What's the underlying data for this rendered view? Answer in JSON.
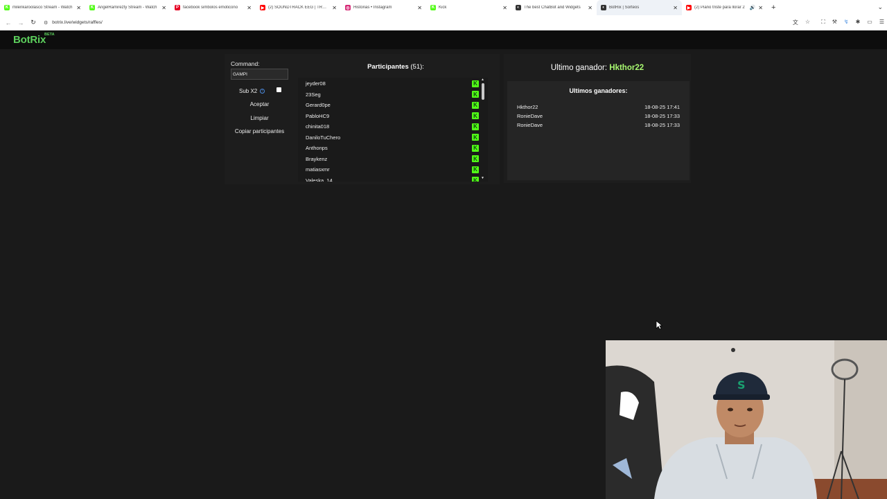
{
  "browser": {
    "tabs": [
      {
        "title": "milenkaroolasco Stream - Watch",
        "favicon": "K",
        "color": "#53fc18"
      },
      {
        "title": "AngelRamirezty Stream - Watch",
        "favicon": "K",
        "color": "#53fc18"
      },
      {
        "title": "facebook simbolos emoticono",
        "favicon": "P",
        "color": "#e60023"
      },
      {
        "title": "(2) SOUNDTRACK EEG | TROMP",
        "favicon": "▶",
        "color": "#ff0000"
      },
      {
        "title": "Historias • Instagram",
        "favicon": "◎",
        "color": "#d62976"
      },
      {
        "title": "Kick",
        "favicon": "K",
        "color": "#53fc18"
      },
      {
        "title": "The best ChatBot and Widgets",
        "favicon": "◐",
        "color": "#333333"
      },
      {
        "title": "BotRix | Sorteos",
        "favicon": "◐",
        "color": "#333333"
      },
      {
        "title": "(2) Piano triste para llorar 2",
        "favicon": "▶",
        "color": "#ff0000"
      }
    ],
    "new_tab": "+",
    "url": "botrix.live/widgets/raffles/"
  },
  "site": {
    "logo": "BotRix",
    "beta": "BETA"
  },
  "raffle": {
    "command_label": "Command:",
    "command_value": "GAMPI",
    "sub_label": "Sub X2",
    "sub_checked": false,
    "accept_label": "Aceptar",
    "clear_label": "Limpiar",
    "copy_label": "Copiar participantes",
    "participants_label": "Participantes",
    "participants_count": "(51):",
    "participants": [
      "jeyder08",
      "23Seg",
      "Gerard0pe",
      "PabloHC9",
      "chinita018",
      "DaniloTuChero",
      "Anthonps",
      "Braykenz",
      "matiasxmr",
      "Valeska_14"
    ],
    "platform_icon": "K"
  },
  "winners": {
    "last_winner_label": "Ultimo ganador:",
    "last_winner_name": "Hkthor22",
    "recent_label": "Ultimos ganadores:",
    "list": [
      {
        "name": "Hkthor22",
        "time": "18-08-25 17:41"
      },
      {
        "name": "RonieDave",
        "time": "18-08-25 17:33"
      },
      {
        "name": "RonieDave",
        "time": "18-08-25 17:33"
      }
    ]
  }
}
